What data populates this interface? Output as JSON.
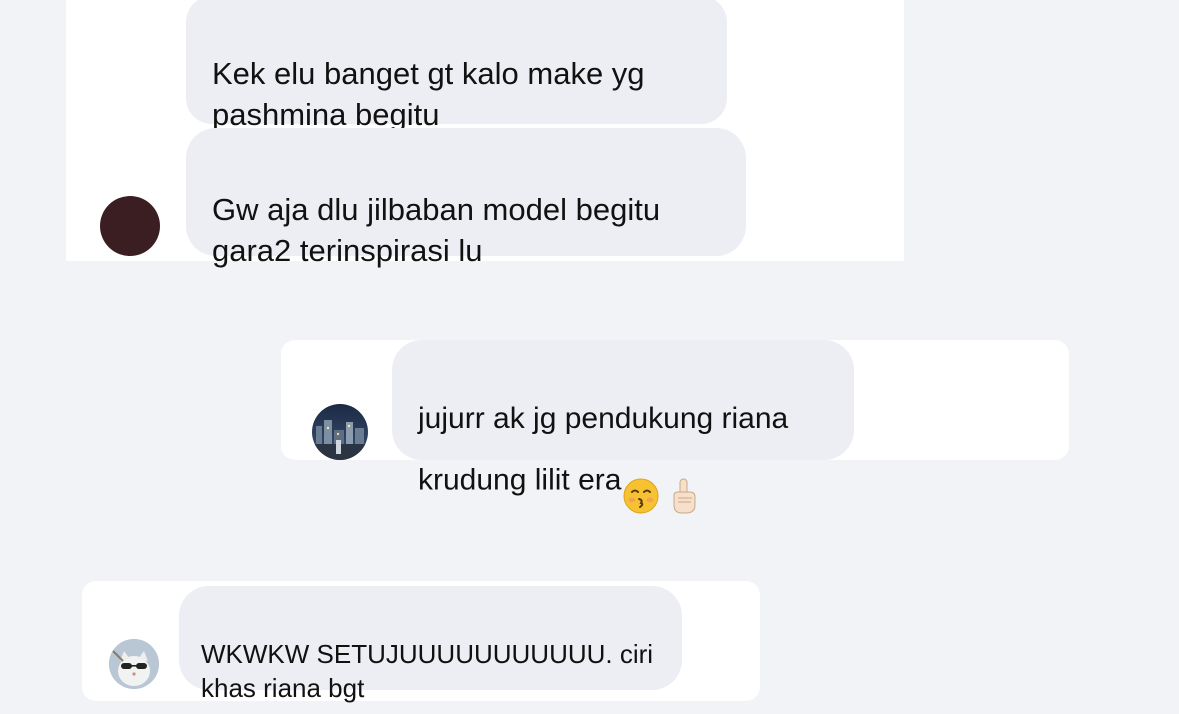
{
  "messages": [
    {
      "text": "Kek elu banget gt kalo make yg\npashmina begitu"
    },
    {
      "text": "Gw aja dlu jilbaban model begitu\ngara2 terinspirasi lu"
    },
    {
      "text": "jujurr ak jg pendukung riana\nkrudung lilit era",
      "emojis": [
        "kissing-face-emoji",
        "pointing-up-emoji"
      ]
    },
    {
      "text": "WKWKW SETUJUUUUUUUUUUU. ciri\nkhas riana bgt"
    }
  ],
  "avatars": [
    {
      "icon": "avatar-dark-circle",
      "color": "#3b1e22"
    },
    {
      "icon": "avatar-night-city-photo"
    },
    {
      "icon": "avatar-cat-sunglasses-photo"
    }
  ],
  "colors": {
    "background": "#f2f3f7",
    "card": "#ffffff",
    "bubble": "#eceef3",
    "text": "#111111"
  }
}
